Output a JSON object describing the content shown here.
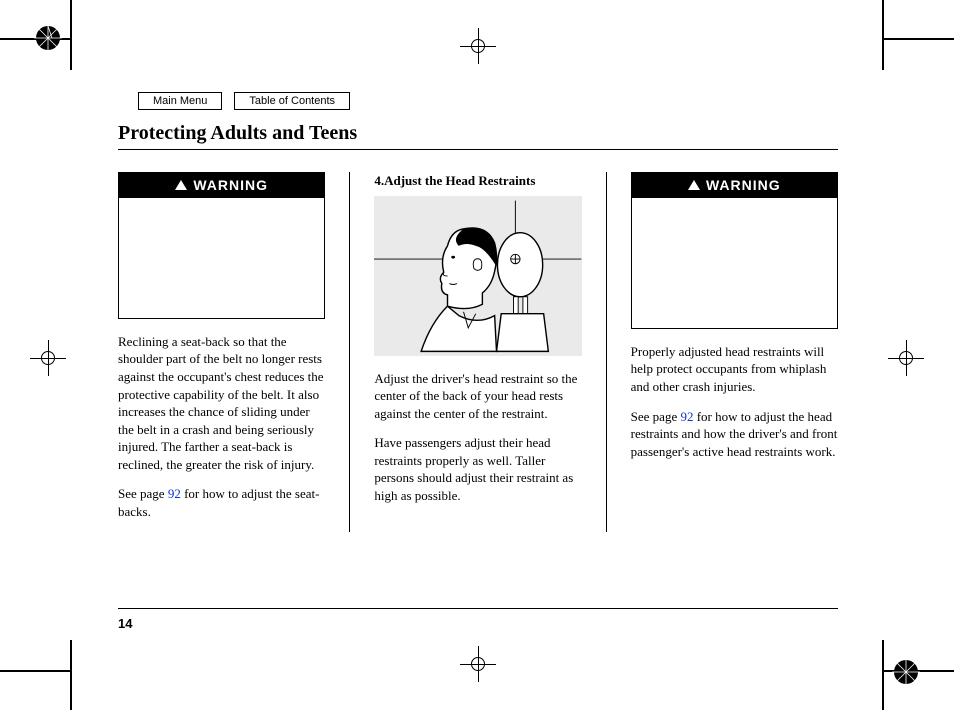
{
  "nav": {
    "main_menu": "Main Menu",
    "toc": "Table of Contents"
  },
  "title": "Protecting Adults and Teens",
  "warning_label": "WARNING",
  "col1": {
    "p1": "Reclining a seat-back so that the shoulder part of the belt no longer rests against the occupant's chest reduces the protective capability of the belt. It also increases the chance of sliding under the belt in a crash and being seriously injured. The farther a seat-back is reclined, the greater the risk of injury.",
    "p2a": "See page ",
    "p2link": "92",
    "p2b": " for how to adjust the seat-backs."
  },
  "col2": {
    "subhead": "4.Adjust the Head Restraints",
    "p1": "Adjust the driver's head restraint so the center of the back of your head rests against the center of the restraint.",
    "p2": "Have passengers adjust their head restraints properly as well. Taller persons should adjust their restraint as high as possible."
  },
  "col3": {
    "p1": "Properly adjusted head restraints will help protect occupants from whiplash and other crash injuries.",
    "p2a": "See page ",
    "p2link": "92",
    "p2b": " for how to adjust the head restraints and how the driver's and front passenger's active head restraints work."
  },
  "page_number": "14"
}
